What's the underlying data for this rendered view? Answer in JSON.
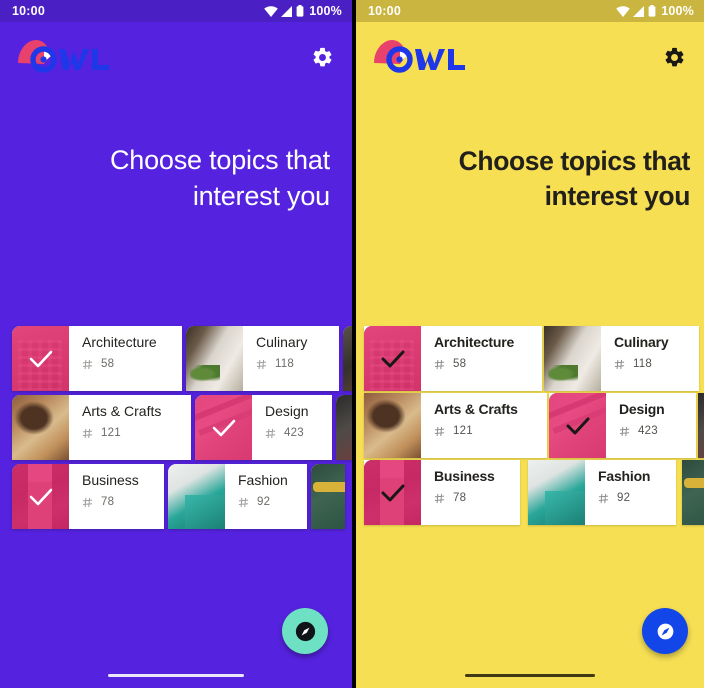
{
  "panels": [
    {
      "theme_name": "purple-theme",
      "colors": {
        "background": "#5523E0",
        "statusbar": "#4A1FC4",
        "accent": "#6EE0C3",
        "selection": "#E8286E",
        "text": "#FFFFFF"
      },
      "statusbar": {
        "clock": "10:00",
        "battery": "100%",
        "wifi_icon": "wifi-icon",
        "signal_icon": "cellular-signal-icon",
        "battery_icon": "battery-full-icon"
      },
      "appbar": {
        "logo_text": "OWL",
        "logo_icon": "owl-logo-icon",
        "settings_icon": "gear-icon"
      },
      "headline": "Choose topics that interest you",
      "topics": [
        {
          "title": "Architecture",
          "count": "58",
          "selected": true,
          "photo": "ph-arch",
          "hash_icon": "hash-icon"
        },
        {
          "title": "Culinary",
          "count": "118",
          "selected": false,
          "photo": "ph-cul",
          "hash_icon": "hash-icon"
        },
        {
          "title": "Arts & Crafts",
          "count": "121",
          "selected": false,
          "photo": "ph-arts",
          "hash_icon": "hash-icon"
        },
        {
          "title": "Design",
          "count": "423",
          "selected": true,
          "photo": "ph-design",
          "hash_icon": "hash-icon"
        },
        {
          "title": "Business",
          "count": "78",
          "selected": true,
          "photo": "ph-bus",
          "hash_icon": "hash-icon"
        },
        {
          "title": "Fashion",
          "count": "92",
          "selected": false,
          "photo": "ph-fash",
          "hash_icon": "hash-icon"
        }
      ],
      "fab": {
        "icon": "explore-compass-icon",
        "label": ""
      },
      "home_indicator": "home-indicator"
    },
    {
      "theme_name": "yellow-theme",
      "colors": {
        "background": "#F6DF53",
        "statusbar": "#C9B53F",
        "accent": "#1246E8",
        "selection": "#E8286E",
        "text": "#22201C"
      },
      "statusbar": {
        "clock": "10:00",
        "battery": "100%",
        "wifi_icon": "wifi-icon",
        "signal_icon": "cellular-signal-icon",
        "battery_icon": "battery-full-icon"
      },
      "appbar": {
        "logo_text": "OWL",
        "logo_icon": "owl-logo-icon",
        "settings_icon": "gear-icon"
      },
      "headline": "Choose topics that interest you",
      "topics": [
        {
          "title": "Architecture",
          "count": "58",
          "selected": true,
          "photo": "ph-arch",
          "hash_icon": "hash-icon"
        },
        {
          "title": "Culinary",
          "count": "118",
          "selected": false,
          "photo": "ph-cul",
          "hash_icon": "hash-icon"
        },
        {
          "title": "Arts & Crafts",
          "count": "121",
          "selected": false,
          "photo": "ph-arts",
          "hash_icon": "hash-icon"
        },
        {
          "title": "Design",
          "count": "423",
          "selected": true,
          "photo": "ph-design",
          "hash_icon": "hash-icon"
        },
        {
          "title": "Business",
          "count": "78",
          "selected": true,
          "photo": "ph-bus",
          "hash_icon": "hash-icon"
        },
        {
          "title": "Fashion",
          "count": "92",
          "selected": false,
          "photo": "ph-fash",
          "hash_icon": "hash-icon"
        }
      ],
      "fab": {
        "icon": "explore-compass-icon",
        "label": ""
      },
      "home_indicator": "home-indicator"
    }
  ]
}
